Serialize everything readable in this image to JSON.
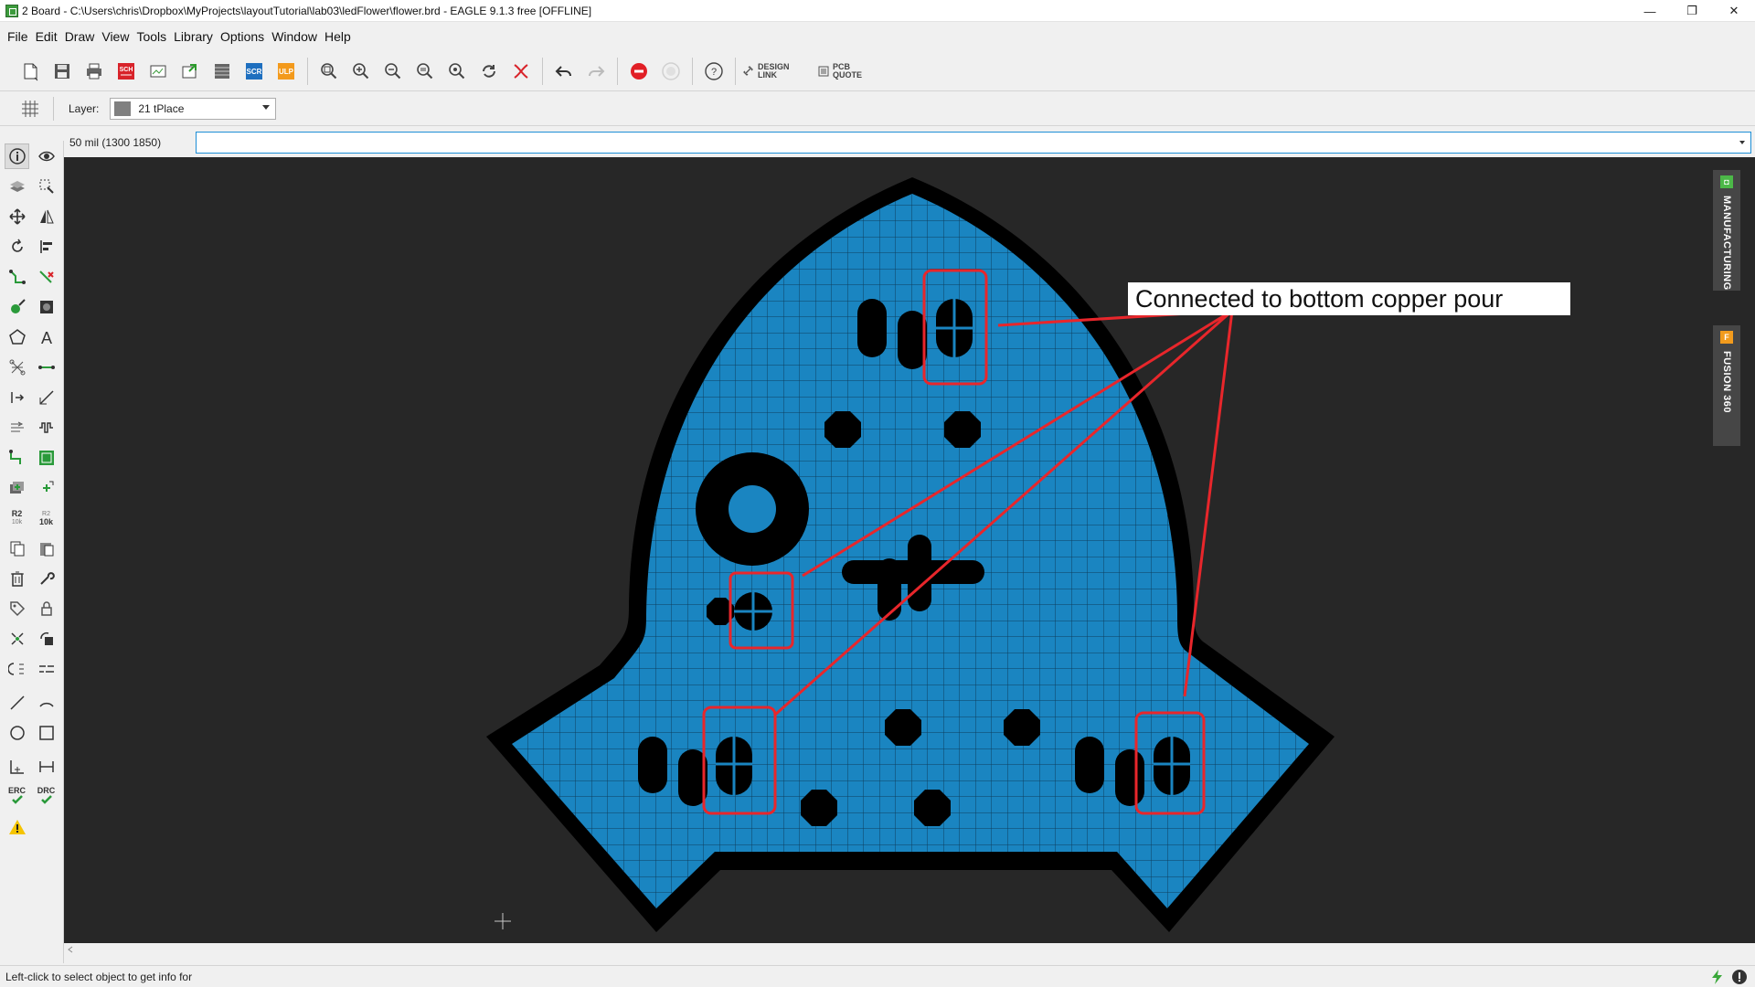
{
  "window": {
    "title": "2 Board - C:\\Users\\chris\\Dropbox\\MyProjects\\layoutTutorial\\lab03\\ledFlower\\flower.brd - EAGLE 9.1.3 free [OFFLINE]",
    "minimize": "—",
    "maximize": "❐",
    "close": "✕"
  },
  "menu": [
    "File",
    "Edit",
    "Draw",
    "View",
    "Tools",
    "Library",
    "Options",
    "Window",
    "Help"
  ],
  "toolbar": {
    "icons": [
      "new-file-icon",
      "save-icon",
      "print-icon",
      "sch-icon",
      "cam-icon",
      "export-icon",
      "layers-icon",
      "script-icon",
      "ulp-icon",
      "zoom-fit-icon",
      "zoom-in-icon",
      "zoom-out-icon",
      "zoom-select-icon",
      "zoom-area-icon",
      "redraw-icon",
      "ratsnest-icon",
      "undo-icon",
      "redo-icon",
      "stop-icon",
      "go-icon",
      "help-icon"
    ],
    "sch_label": "SCH",
    "scr_label": "SCR",
    "ulp_label": "ULP",
    "design_link": "DESIGN\nLINK",
    "pcb_quote": "PCB\nQUOTE"
  },
  "layerbar": {
    "label": "Layer:",
    "selected_layer": "21 tPlace",
    "layer_color": "#808080"
  },
  "cmdbar": {
    "coordinates": "50 mil (1300 1850)",
    "command_value": ""
  },
  "lefttools": {
    "r2_label": "R2",
    "r2_sub": "10k",
    "r2b_label": "R2",
    "r2b_sub": "10k",
    "erc_label": "ERC",
    "drc_label": "DRC"
  },
  "sidepanels": {
    "manufacturing": "MANUFACTURING",
    "manufacturing_badge": "◘",
    "fusion": "FUSION 360",
    "fusion_badge": "F"
  },
  "annotation": {
    "text": "Connected to bottom copper pour"
  },
  "status": {
    "text": "Left-click to select object to get info for"
  },
  "colors": {
    "board_fill": "#1a85c1",
    "board_outline": "#000000",
    "canvas_bg": "#272727",
    "highlight": "#e8262b",
    "manufacturing_badge": "#4cb848",
    "fusion_badge": "#f29b1d"
  }
}
